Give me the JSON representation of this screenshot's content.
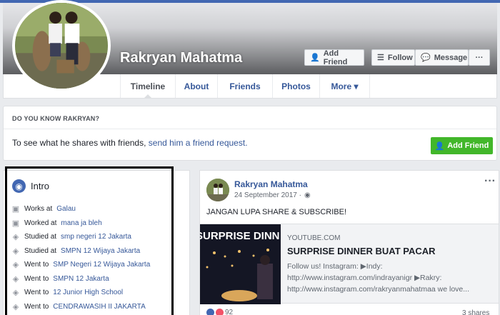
{
  "profile": {
    "name": "Rakryan Mahatma",
    "buttons": {
      "add_friend": "Add Friend",
      "follow": "Follow",
      "message": "Message",
      "more": "···"
    }
  },
  "nav": {
    "tabs": [
      {
        "label": "Timeline",
        "active": true
      },
      {
        "label": "About"
      },
      {
        "label": "Friends"
      },
      {
        "label": "Photos"
      },
      {
        "label": "More ▾"
      }
    ]
  },
  "know": {
    "title": "DO YOU KNOW RAKRYAN?",
    "text": "To see what he shares with friends,",
    "link": "send him a friend request.",
    "button": "Add Friend"
  },
  "intro": {
    "title": "Intro",
    "items": [
      {
        "icon": "briefcase-icon",
        "prefix": "Works at",
        "link": "Galau"
      },
      {
        "icon": "briefcase-icon",
        "prefix": "Worked at",
        "link": "mana ja bleh"
      },
      {
        "icon": "graduation-cap-icon",
        "prefix": "Studied at",
        "link": "smp negeri 12 Jakarta"
      },
      {
        "icon": "graduation-cap-icon",
        "prefix": "Studied at",
        "link": "SMPN 12 Wijaya Jakarta"
      },
      {
        "icon": "graduation-cap-icon",
        "prefix": "Went to",
        "link": "SMP Negeri 12 Wijaya Jakarta"
      },
      {
        "icon": "graduation-cap-icon",
        "prefix": "Went to",
        "link": "SMPN 12 Jakarta"
      },
      {
        "icon": "graduation-cap-icon",
        "prefix": "Went to",
        "link": "12 Junior High School"
      },
      {
        "icon": "graduation-cap-icon",
        "prefix": "Went to",
        "link": "CENDRAWASIH II JAKARTA"
      }
    ]
  },
  "post": {
    "author": "Rakryan Mahatma",
    "date": "24 September 2017 ·",
    "more": "···",
    "text": "JANGAN LUPA SHARE & SUBSCRIBE!",
    "share": {
      "thumb_text": "SURPRISE DINN",
      "site": "YOUTUBE.COM",
      "title": "SURPRISE DINNER BUAT PACAR",
      "desc": "Follow us! Instagram: ▶Indy: http://www.instagram.com/indrayanigr ▶Rakry: http://www.instagram.com/rakryanmahatmaa we love..."
    },
    "reactions_count": "92",
    "shares": "3 shares"
  },
  "colors": {
    "brand": "#4267b2",
    "link": "#365899",
    "green": "#42b72a"
  }
}
